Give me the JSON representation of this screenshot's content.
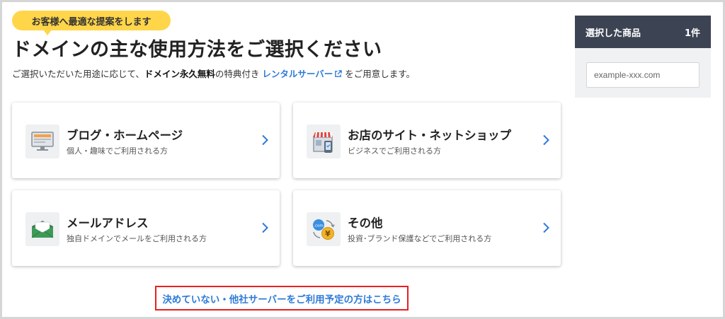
{
  "header": {
    "badge": "お客様へ最適な提案をします",
    "title": "ドメインの主な使用方法をご選択ください",
    "subtitle_prefix": "ご選択いただいた用途に応じて、",
    "subtitle_bold": "ドメイン永久無料",
    "subtitle_middle": "の特典付き",
    "subtitle_link": "レンタルサーバー",
    "subtitle_suffix": "をご用意します。"
  },
  "cards": [
    {
      "title": "ブログ・ホームページ",
      "desc": "個人・趣味でご利用される方",
      "icon": "monitor-icon"
    },
    {
      "title": "お店のサイト・ネットショップ",
      "desc": "ビジネスでご利用される方",
      "icon": "shop-icon"
    },
    {
      "title": "メールアドレス",
      "desc": "独自ドメインでメールをご利用される方",
      "icon": "mail-icon"
    },
    {
      "title": "その他",
      "desc": "投資･ブランド保護などでご利用される方",
      "icon": "coin-exchange-icon"
    }
  ],
  "bottom_link": "決めていない・他社サーバーをご利用予定の方はこちら",
  "sidebar": {
    "heading": "選択した商品",
    "count": "1件",
    "input_placeholder": "example-xxx.com"
  },
  "colors": {
    "badge": "#ffd54a",
    "link": "#2f7bd8",
    "highlight_border": "#e8201f",
    "sidebar_header": "#3c4453"
  }
}
